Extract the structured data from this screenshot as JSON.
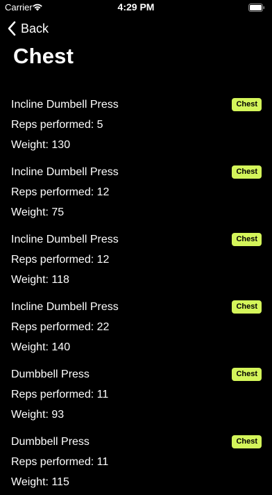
{
  "status_bar": {
    "carrier": "Carrier",
    "time": "4:29 PM"
  },
  "nav": {
    "back_label": "Back"
  },
  "page": {
    "title": "Chest"
  },
  "colors": {
    "background": "#000000",
    "tag_background": "#d4f55a",
    "text": "#ffffff"
  },
  "exercises": [
    {
      "name": "Incline Dumbell Press",
      "reps": "Reps performed: 5",
      "weight": "Weight: 130",
      "tag": "Chest"
    },
    {
      "name": "Incline Dumbell Press",
      "reps": "Reps performed: 12",
      "weight": "Weight: 75",
      "tag": "Chest"
    },
    {
      "name": "Incline Dumbell Press",
      "reps": "Reps performed: 12",
      "weight": "Weight: 118",
      "tag": "Chest"
    },
    {
      "name": "Incline Dumbell Press",
      "reps": "Reps performed: 22",
      "weight": "Weight: 140",
      "tag": "Chest"
    },
    {
      "name": "Dumbbell Press",
      "reps": "Reps performed: 11",
      "weight": "Weight: 93",
      "tag": "Chest"
    },
    {
      "name": "Dumbbell Press",
      "reps": "Reps performed: 11",
      "weight": "Weight: 115",
      "tag": "Chest"
    }
  ]
}
